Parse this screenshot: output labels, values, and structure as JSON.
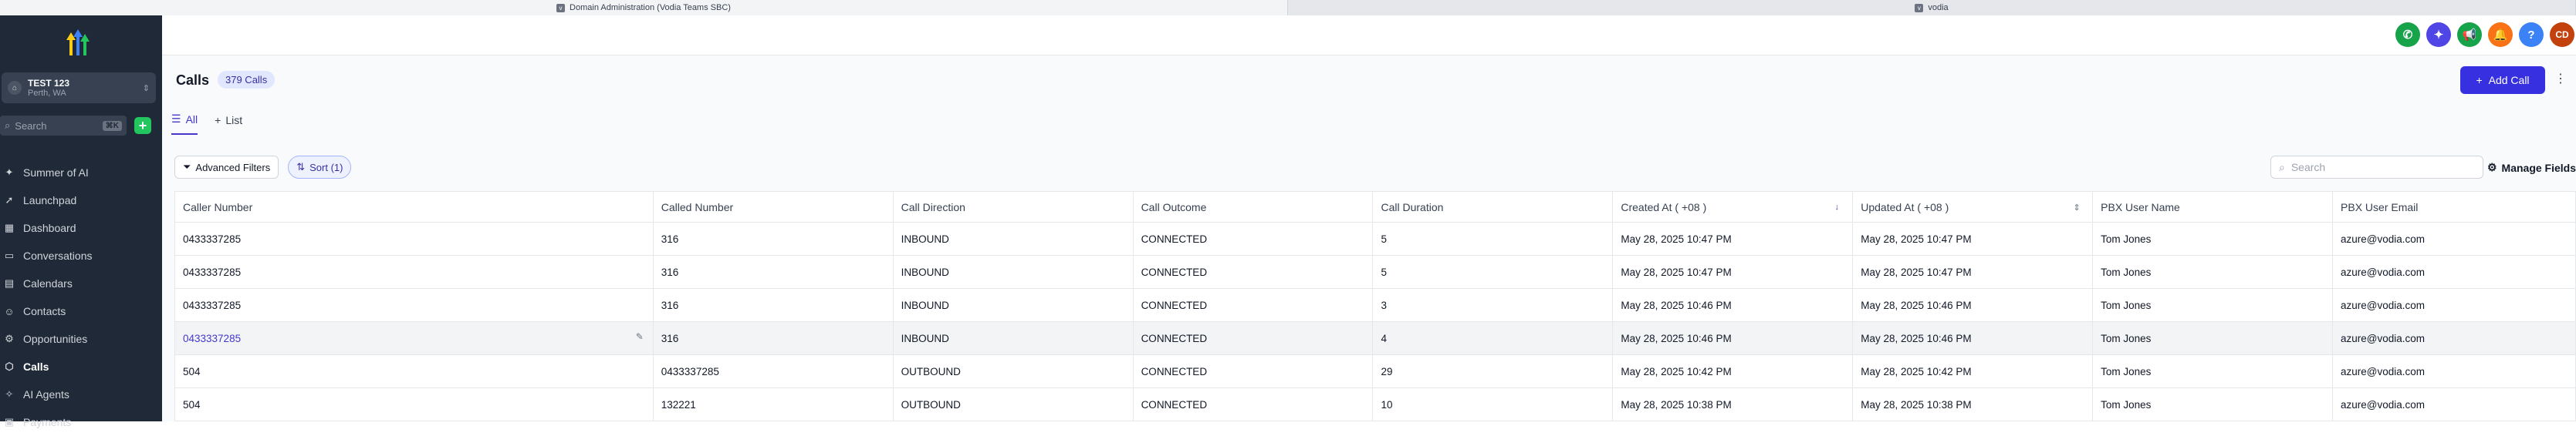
{
  "browser_tabs": [
    {
      "icon": "v",
      "title": "Domain Administration (Vodia Teams SBC)"
    },
    {
      "icon": "v",
      "title": "vodia"
    }
  ],
  "sidebar": {
    "account_name": "TEST 123",
    "account_location": "Perth, WA",
    "search_placeholder": "Search",
    "search_shortcut": "⌘K",
    "items": [
      {
        "label": "Summer of AI",
        "icon": "sparkle-icon"
      },
      {
        "label": "Launchpad",
        "icon": "rocket-icon"
      },
      {
        "label": "Dashboard",
        "icon": "dashboard-icon"
      },
      {
        "label": "Conversations",
        "icon": "chat-icon"
      },
      {
        "label": "Calendars",
        "icon": "calendar-icon"
      },
      {
        "label": "Contacts",
        "icon": "contacts-icon"
      },
      {
        "label": "Opportunities",
        "icon": "opportunities-icon"
      },
      {
        "label": "Calls",
        "icon": "calls-icon",
        "active": true
      },
      {
        "label": "AI Agents",
        "icon": "ai-agent-icon"
      },
      {
        "label": "Payments",
        "icon": "payments-icon"
      }
    ]
  },
  "topbar": {
    "avatar_initials": "CD",
    "help_glyph": "?",
    "colors": {
      "phone": "#16a34a",
      "magic": "#4f46e5",
      "megaphone": "#16a34a",
      "bell": "#f97316",
      "help": "#3b82f6",
      "avatar": "#c2410c"
    }
  },
  "page": {
    "title": "Calls",
    "count_badge": "379 Calls",
    "add_button": "Add Call"
  },
  "tabs": [
    {
      "label": "All",
      "active": true
    },
    {
      "label": "List",
      "active": false
    }
  ],
  "filters": {
    "advanced": "Advanced Filters",
    "sort": "Sort (1)",
    "search_placeholder": "Search",
    "manage": "Manage Fields"
  },
  "table": {
    "columns": [
      "Caller Number",
      "Called Number",
      "Call Direction",
      "Call Outcome",
      "Call Duration",
      "Created At ( +08 )",
      "Updated At ( +08 )",
      "PBX User Name",
      "PBX User Email"
    ],
    "rows": [
      [
        "0433337285",
        "316",
        "INBOUND",
        "CONNECTED",
        "5",
        "May 28, 2025 10:47 PM",
        "May 28, 2025 10:47 PM",
        "Tom Jones",
        "azure@vodia.com"
      ],
      [
        "0433337285",
        "316",
        "INBOUND",
        "CONNECTED",
        "5",
        "May 28, 2025 10:47 PM",
        "May 28, 2025 10:47 PM",
        "Tom Jones",
        "azure@vodia.com"
      ],
      [
        "0433337285",
        "316",
        "INBOUND",
        "CONNECTED",
        "3",
        "May 28, 2025 10:46 PM",
        "May 28, 2025 10:46 PM",
        "Tom Jones",
        "azure@vodia.com"
      ],
      [
        "0433337285",
        "316",
        "INBOUND",
        "CONNECTED",
        "4",
        "May 28, 2025 10:46 PM",
        "May 28, 2025 10:46 PM",
        "Tom Jones",
        "azure@vodia.com"
      ],
      [
        "504",
        "0433337285",
        "OUTBOUND",
        "CONNECTED",
        "29",
        "May 28, 2025 10:42 PM",
        "May 28, 2025 10:42 PM",
        "Tom Jones",
        "azure@vodia.com"
      ],
      [
        "504",
        "132221",
        "OUTBOUND",
        "CONNECTED",
        "10",
        "May 28, 2025 10:38 PM",
        "May 28, 2025 10:38 PM",
        "Tom Jones",
        "azure@vodia.com"
      ]
    ],
    "hover_row": 3
  }
}
